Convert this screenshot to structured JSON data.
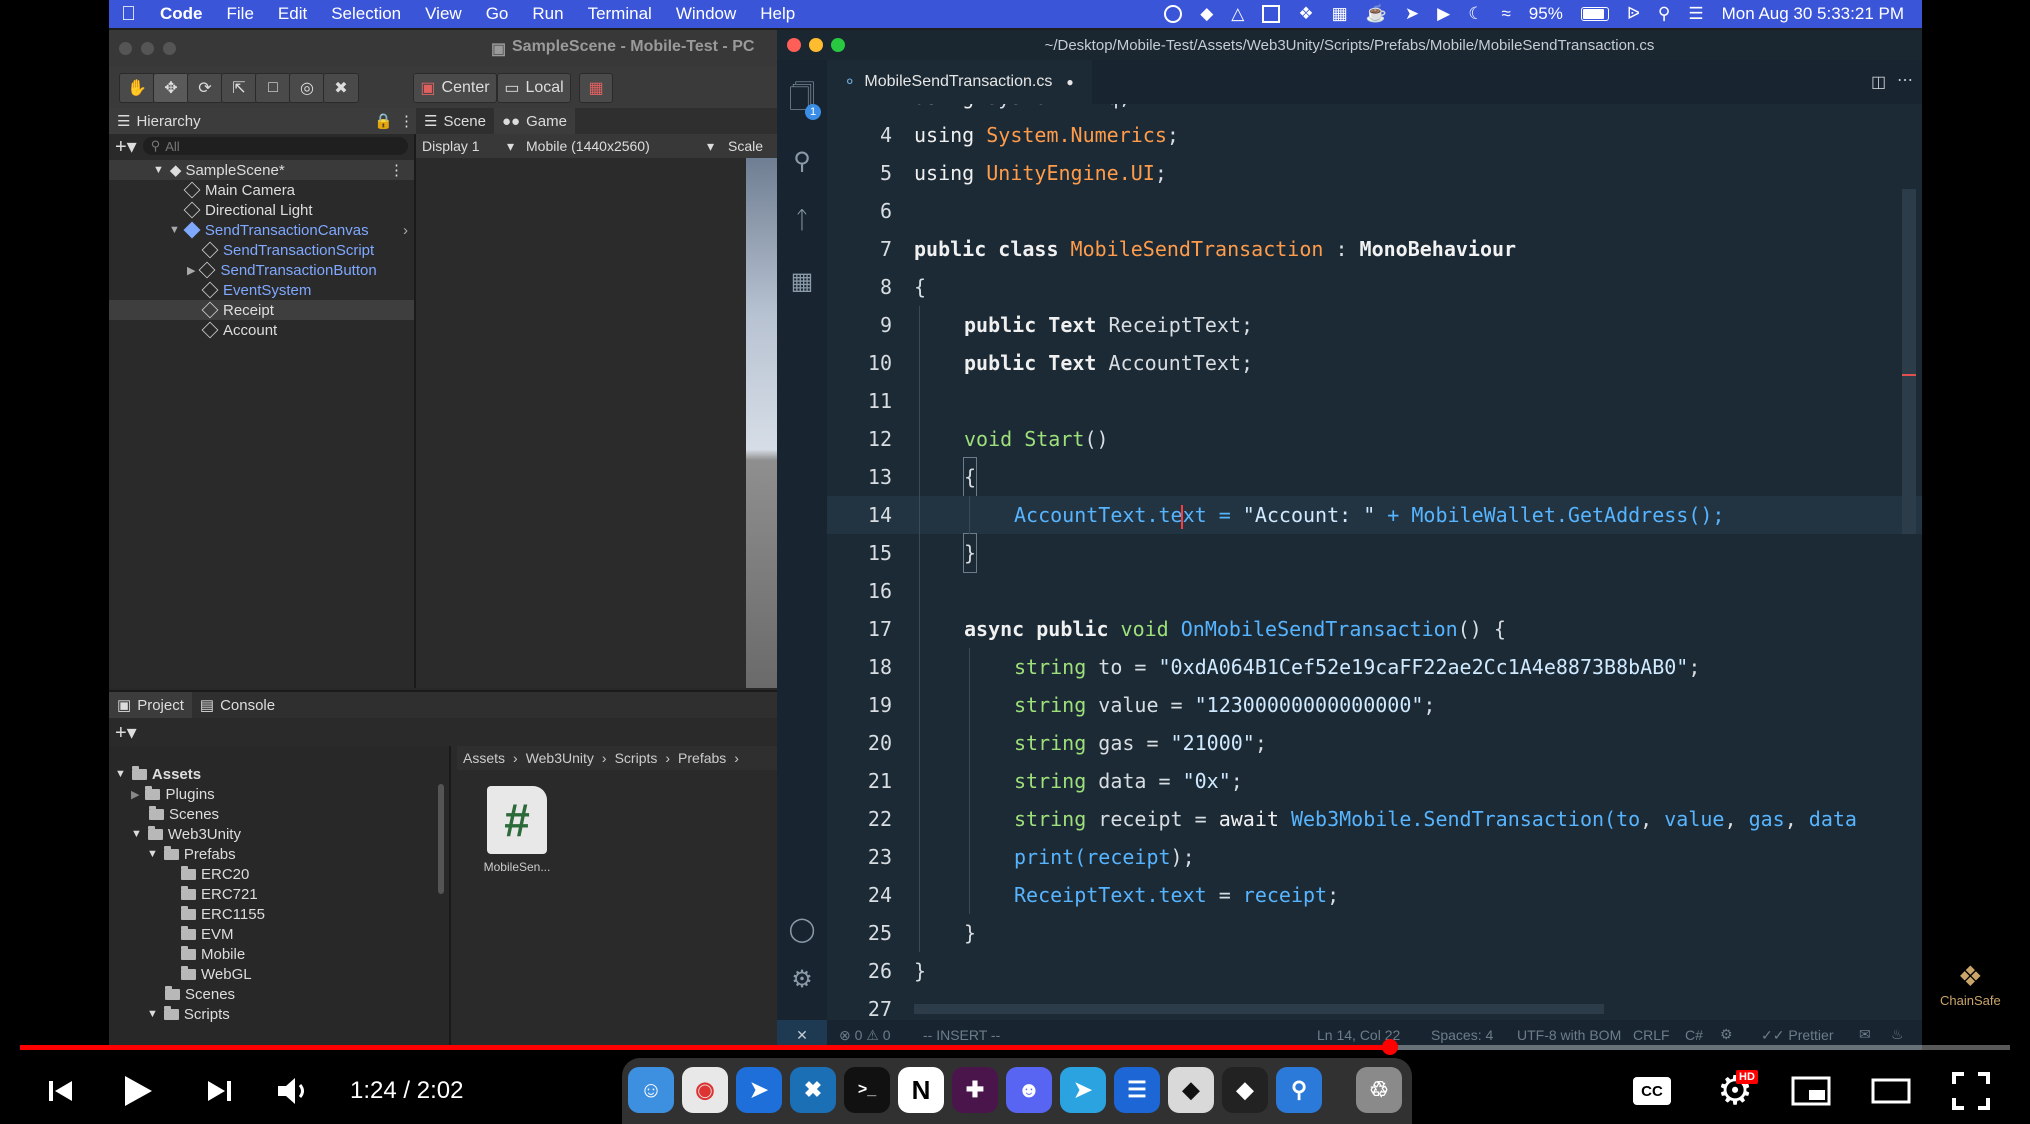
{
  "menubar": {
    "items": [
      "Code",
      "File",
      "Edit",
      "Selection",
      "View",
      "Go",
      "Run",
      "Terminal",
      "Window",
      "Help"
    ],
    "battery": "95%",
    "datetime": "Mon Aug 30  5:33:21 PM"
  },
  "unity": {
    "title": "SampleScene - Mobile-Test - PC",
    "toolbar": {
      "center": "Center",
      "local": "Local"
    },
    "hierarchy": {
      "tab": "Hierarchy",
      "search_placeholder": "All",
      "scene": "SampleScene*",
      "items": [
        "Main Camera",
        "Directional Light",
        "SendTransactionCanvas",
        "SendTransactionScript",
        "SendTransactionButton",
        "EventSystem",
        "Receipt",
        "Account"
      ]
    },
    "game": {
      "tab_scene": "Scene",
      "tab_game": "Game",
      "display": "Display 1",
      "resolution": "Mobile (1440x2560)",
      "scale": "Scale"
    },
    "project": {
      "tab_project": "Project",
      "tab_console": "Console",
      "breadcrumb": [
        "Assets",
        "Web3Unity",
        "Scripts",
        "Prefabs"
      ],
      "tree": [
        "Assets",
        "Plugins",
        "Scenes",
        "Web3Unity",
        "Prefabs",
        "ERC20",
        "ERC721",
        "ERC1155",
        "EVM",
        "Mobile",
        "WebGL",
        "Scenes",
        "Scripts"
      ],
      "asset_label": "MobileSen..."
    }
  },
  "vscode": {
    "title": "~/Desktop/Mobile-Test/Assets/Web3Unity/Scripts/Prefabs/Mobile/MobileSendTransaction.cs",
    "tab": "MobileSendTransaction.cs",
    "explorer_badge": "1",
    "status": {
      "errors": "0",
      "warnings": "0",
      "mode": "-- INSERT --",
      "position": "Ln 14, Col 22",
      "spaces": "Spaces: 4",
      "encoding": "UTF-8 with BOM",
      "eol": "CRLF",
      "lang": "C#",
      "prettier": "Prettier"
    },
    "line_numbers": [
      "4",
      "5",
      "6",
      "7",
      "8",
      "9",
      "10",
      "11",
      "12",
      "13",
      "14",
      "15",
      "16",
      "17",
      "18",
      "19",
      "20",
      "21",
      "22",
      "23",
      "24",
      "25",
      "26",
      "27"
    ],
    "code": {
      "l4": [
        "using ",
        "System.Numerics",
        ";"
      ],
      "l5": [
        "using ",
        "UnityEngine.UI",
        ";"
      ],
      "l7": [
        "public class ",
        "MobileSendTransaction",
        " : ",
        "MonoBehaviour"
      ],
      "l8": [
        "{"
      ],
      "l9": [
        "public Text ",
        "ReceiptText;"
      ],
      "l10": [
        "public Text ",
        "AccountText;"
      ],
      "l12": [
        "void ",
        "Start",
        "()"
      ],
      "l13": [
        "{"
      ],
      "l14": [
        "AccountText",
        ".te",
        "xt = ",
        "\"Account: \"",
        " + MobileWallet.GetAddress();"
      ],
      "l15": [
        "}"
      ],
      "l17": [
        "async public ",
        "void ",
        "OnMobileSendTransaction",
        "() {"
      ],
      "l18": [
        "string ",
        "to = ",
        "\"0xdA064B1Cef52e19caFF22ae2Cc1A4e8873B8bAB0\"",
        ";"
      ],
      "l19": [
        "string ",
        "value = ",
        "\"12300000000000000\"",
        ";"
      ],
      "l20": [
        "string ",
        "gas = ",
        "\"21000\"",
        ";"
      ],
      "l21": [
        "string ",
        "data = ",
        "\"0x\"",
        ";"
      ],
      "l22": [
        "string ",
        "receipt = ",
        "await ",
        "Web3Mobile.SendTransaction(",
        "to",
        ", ",
        "value",
        ", ",
        "gas",
        ", ",
        "data"
      ],
      "l23": [
        "print(",
        "receipt",
        ");"
      ],
      "l24": [
        "ReceiptText.text",
        " = ",
        "receipt",
        ";"
      ],
      "l25": [
        "}"
      ],
      "l26": [
        "}"
      ]
    }
  },
  "player": {
    "time": "1:24 / 2:02",
    "progress": 0.6885,
    "watermark": "ChainSafe",
    "hd_badge": "HD"
  },
  "colors": {
    "menubar": "#3b55d9",
    "progress": "#ff0000",
    "editor_bg": "#1c2a35"
  }
}
